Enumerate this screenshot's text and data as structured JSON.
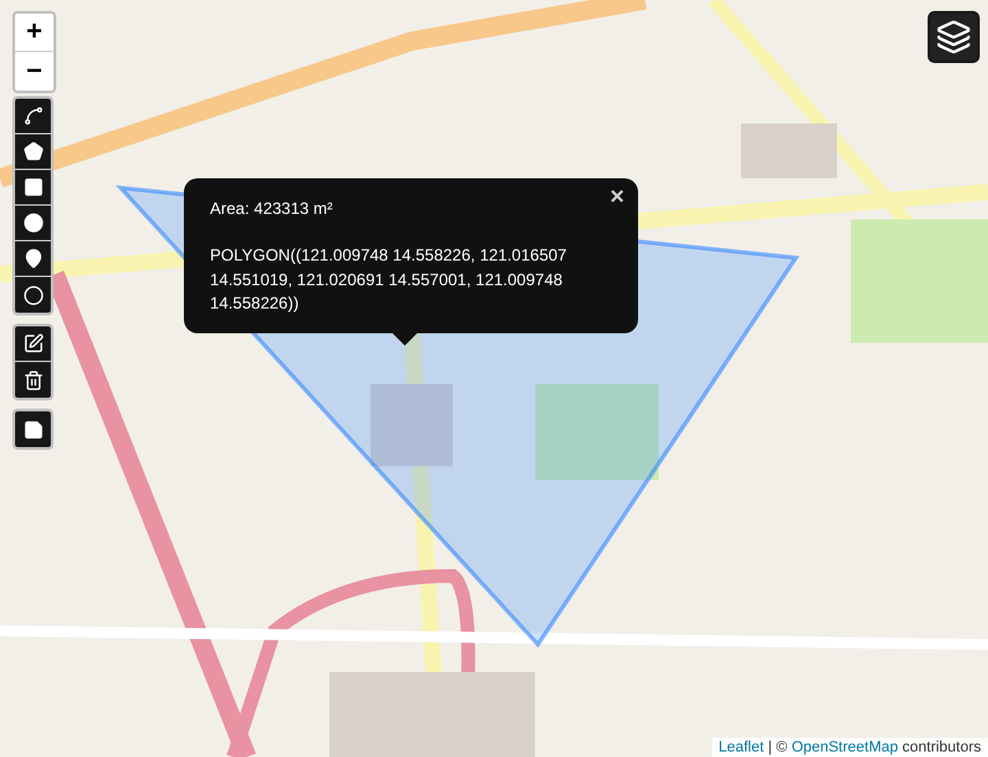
{
  "zoom_controls": [
    {
      "label": "+"
    },
    {
      "label": "−"
    }
  ],
  "draw_tools": [
    {
      "kind": "polyline"
    },
    {
      "kind": "polygon"
    },
    {
      "kind": "rectangle"
    },
    {
      "kind": "circle"
    },
    {
      "kind": "marker"
    },
    {
      "kind": "circlemarker"
    }
  ],
  "edit_tools": [
    {
      "kind": "edit"
    },
    {
      "kind": "delete"
    }
  ],
  "save_tool": {
    "kind": "save"
  },
  "popup": {
    "area": "Area: 423313 m²",
    "wkt": "POLYGON((121.009748 14.558226, 121.016507 14.551019, 121.020691 14.557001, 121.009748 14.558226))",
    "close": "×"
  },
  "attribution": {
    "library": "Leaflet",
    "separator": "|",
    "prefix": "©",
    "provider": "OpenStreetMap",
    "suffix": "contributors"
  }
}
